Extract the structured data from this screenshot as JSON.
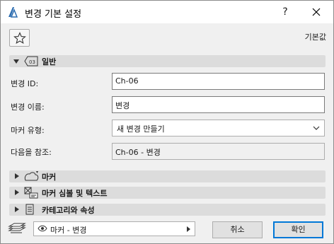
{
  "window": {
    "title": "변경 기본 설정",
    "help_label": "?"
  },
  "toolbar": {
    "favorites_icon": "star-icon",
    "defaults_label": "기본값"
  },
  "sections": {
    "general": {
      "label": "일반",
      "expanded": true,
      "icon": "marker-tag-icon",
      "badge": "03"
    },
    "marker": {
      "label": "마커",
      "expanded": false,
      "icon": "marker-shape-icon"
    },
    "symbol_text": {
      "label": "마커 심볼 및 텍스트",
      "expanded": false,
      "icon": "symbol-text-icon"
    },
    "category": {
      "label": "카테고리와 속성",
      "expanded": false,
      "icon": "document-list-icon"
    }
  },
  "fields": {
    "change_id": {
      "label": "변경 ID:",
      "value": "Ch-06"
    },
    "change_name": {
      "label": "변경 이름:",
      "value": "변경"
    },
    "marker_type": {
      "label": "마커 유형:",
      "value": "새 변경 만들기"
    },
    "refer_to": {
      "label": "다음을 참조:",
      "value": "Ch-06 - 변경"
    }
  },
  "footer": {
    "view_icon": "layers-stack-icon",
    "view_select_value": "마커 - 변경",
    "cancel_label": "취소",
    "ok_label": "확인"
  },
  "colors": {
    "accent": "#0078d7",
    "dialog_bg": "#f0f0f0",
    "section_bg": "#dcdcdc"
  }
}
